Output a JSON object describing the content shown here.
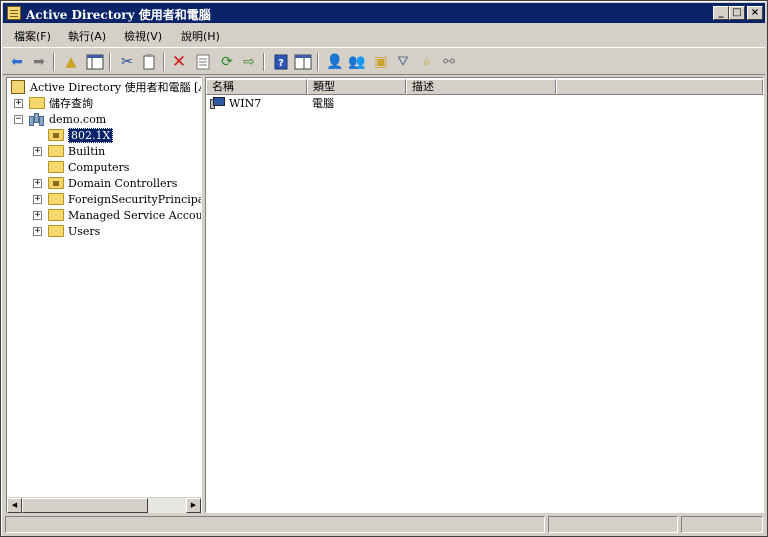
{
  "window": {
    "title": "Active Directory 使用者和電腦"
  },
  "title_buttons": {
    "minimize": "_",
    "maximize": "□",
    "close": "×"
  },
  "menu": [
    "檔案(F)",
    "執行(A)",
    "檢視(V)",
    "說明(H)"
  ],
  "toolbar": [
    "back-icon",
    "forward-icon",
    "up-folder-icon",
    "show-hide-tree-icon",
    "cut-icon",
    "copy-icon",
    "delete-icon",
    "properties-icon",
    "refresh-icon",
    "export-list-icon",
    "help-icon",
    "console-tree-icon",
    "add-user-icon",
    "add-group-icon",
    "add-ou-icon",
    "filter-icon",
    "find-icon",
    "add-to-group-icon"
  ],
  "tree": {
    "root": "Active Directory 使用者和電腦 [A:",
    "saved_queries": "儲存查詢",
    "domain": "demo.com",
    "children": [
      "802.1X",
      "Builtin",
      "Computers",
      "Domain Controllers",
      "ForeignSecurityPrincipals",
      "Managed Service Accounts",
      "Users"
    ],
    "selected": "802.1X"
  },
  "list": {
    "columns": [
      "名稱",
      "類型",
      "描述"
    ],
    "rows": [
      {
        "name": "WIN7",
        "type": "電腦",
        "description": ""
      }
    ]
  },
  "colors": {
    "title_bar": "#0a246a",
    "selection": "#0a246a",
    "chrome": "#d4d0c8"
  }
}
